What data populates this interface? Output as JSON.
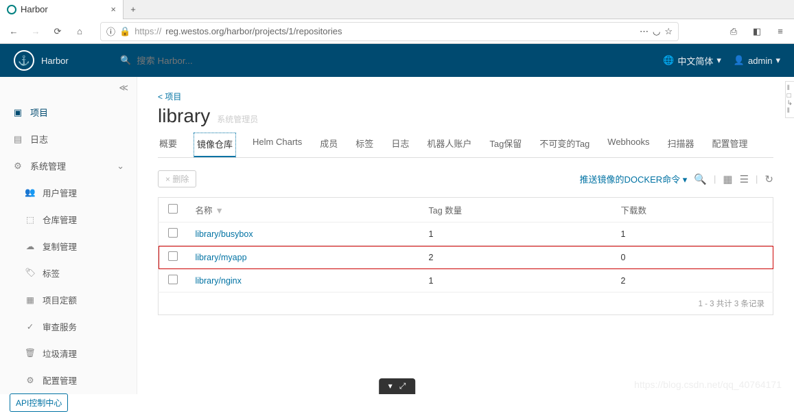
{
  "browser": {
    "tab_title": "Harbor",
    "url_proto": "https://",
    "url_rest": "reg.westos.org/harbor/projects/1/repositories"
  },
  "header": {
    "brand": "Harbor",
    "search_placeholder": "搜索 Harbor...",
    "language": "中文简体",
    "user": "admin"
  },
  "sidebar": {
    "projects": "项目",
    "logs": "日志",
    "admin": "系统管理",
    "sub": {
      "users": "用户管理",
      "repos": "仓库管理",
      "replication": "复制管理",
      "labels": "标签",
      "quota": "项目定额",
      "audit": "审查服务",
      "gc": "垃圾清理",
      "config": "配置管理"
    },
    "api_btn": "API控制中心"
  },
  "main": {
    "breadcrumb": "< 项目",
    "title": "library",
    "subtitle": "系统管理员",
    "tabs": [
      "概要",
      "镜像仓库",
      "Helm Charts",
      "成员",
      "标签",
      "日志",
      "机器人账户",
      "Tag保留",
      "不可变的Tag",
      "Webhooks",
      "扫描器",
      "配置管理"
    ],
    "active_tab_index": 1,
    "delete_btn": "× 删除",
    "push_cmd": "推送镜像的DOCKER命令",
    "cols": {
      "name": "名称",
      "tags": "Tag 数量",
      "pulls": "下载数"
    },
    "rows": [
      {
        "name": "library/busybox",
        "tags": "1",
        "pulls": "1",
        "highlight": false
      },
      {
        "name": "library/myapp",
        "tags": "2",
        "pulls": "0",
        "highlight": true
      },
      {
        "name": "library/nginx",
        "tags": "1",
        "pulls": "2",
        "highlight": false
      }
    ],
    "footer": "1 - 3 共计 3 条记录"
  },
  "watermark": "https://blog.csdn.net/qq_40764171"
}
